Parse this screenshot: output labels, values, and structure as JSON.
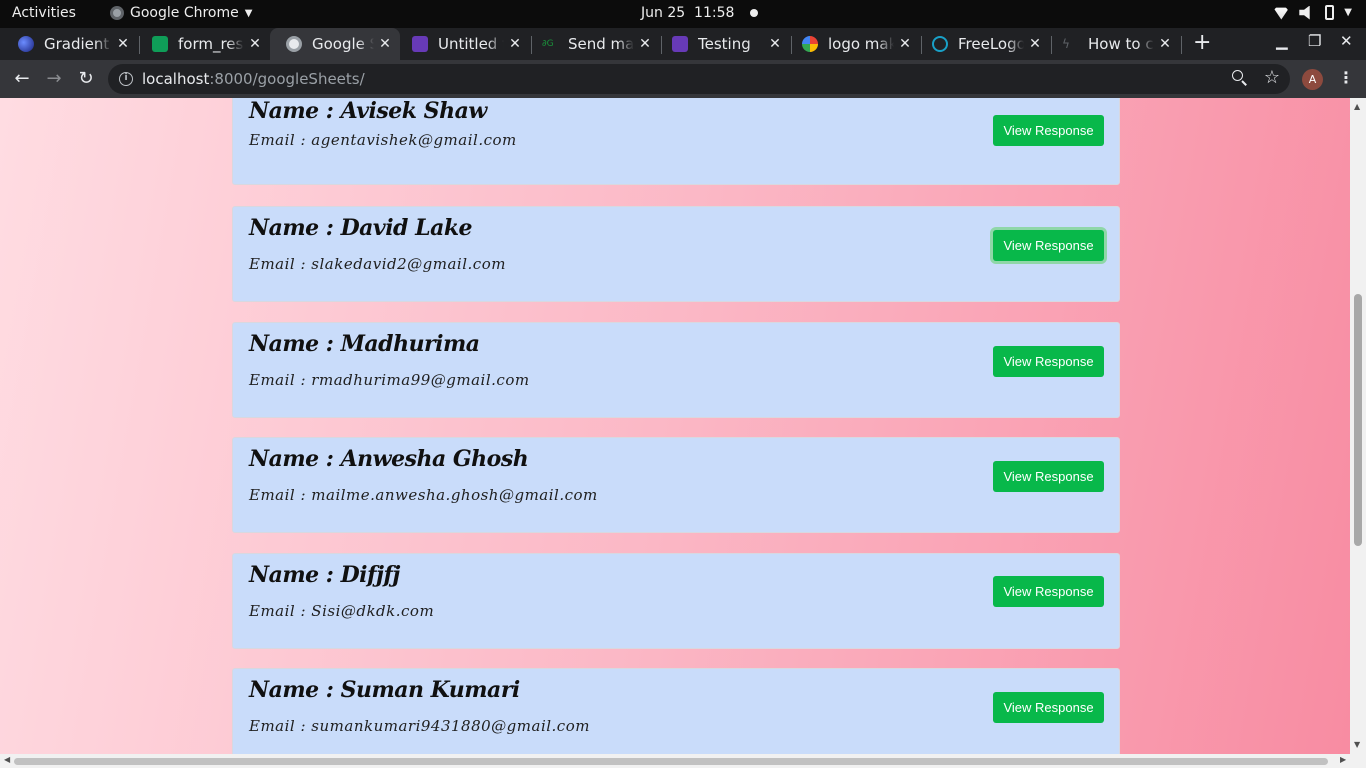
{
  "system_bar": {
    "activities": "Activities",
    "app_name": "Google Chrome",
    "date": "Jun 25",
    "time": "11:58"
  },
  "tabs": [
    {
      "title": "Gradient",
      "favicon_color": "#3b5bdb",
      "active": false
    },
    {
      "title": "form_resp",
      "favicon_color": "#0f9d58",
      "active": false
    },
    {
      "title": "Google Sh",
      "favicon_color": "#9aa0a6",
      "active": true
    },
    {
      "title": "Untitled f",
      "favicon_color": "#673ab7",
      "active": false
    },
    {
      "title": "Send mail",
      "favicon_color": "#1a8f3a",
      "active": false
    },
    {
      "title": "Testing",
      "favicon_color": "#673ab7",
      "active": false
    },
    {
      "title": "logo make",
      "favicon_color": "#ea4335",
      "active": false
    },
    {
      "title": "FreeLogo",
      "favicon_color": "#19a0c7",
      "active": false
    },
    {
      "title": "How to c",
      "favicon_color": "#5f6368",
      "active": false
    }
  ],
  "omnibox": {
    "host": "localhost",
    "path": ":8000/googleSheets/"
  },
  "profile_initial": "A",
  "cards": [
    {
      "name": "Name : Avisek Shaw",
      "email": "Email : agentavishek@gmail.com",
      "button": "View Response"
    },
    {
      "name": "Name : David Lake",
      "email": "Email : slakedavid2@gmail.com",
      "button": "View Response"
    },
    {
      "name": "Name : Madhurima",
      "email": "Email : rmadhurima99@gmail.com",
      "button": "View Response"
    },
    {
      "name": "Name : Anwesha Ghosh",
      "email": "Email : mailme.anwesha.ghosh@gmail.com",
      "button": "View Response"
    },
    {
      "name": "Name : Difjfj",
      "email": "Email : Sisi@dkdk.com",
      "button": "View Response"
    },
    {
      "name": "Name : Suman Kumari",
      "email": "Email : sumankumari9431880@gmail.com",
      "button": "View Response"
    }
  ]
}
